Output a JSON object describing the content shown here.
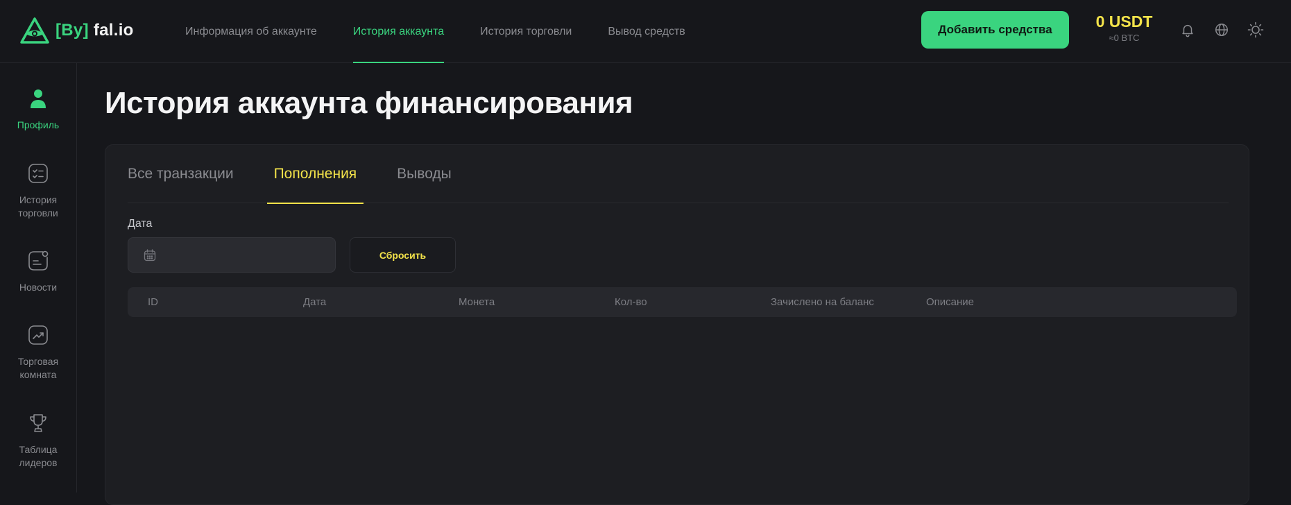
{
  "header": {
    "logo_bracket": "[By]",
    "logo_rest": "fal.io",
    "nav": [
      {
        "label": "Информация об аккаунте"
      },
      {
        "label": "История аккаунта"
      },
      {
        "label": "История торговли"
      },
      {
        "label": "Вывод средств"
      }
    ],
    "active_nav": "История аккаунта",
    "add_funds_label": "Добавить средства",
    "balance_main": "0 USDT",
    "balance_sub": "≈0 BTC",
    "icons": [
      "bell-icon",
      "globe-icon",
      "sun-icon"
    ]
  },
  "sidebar": {
    "items": [
      {
        "label": "Профиль",
        "icon": "user-icon",
        "active": true
      },
      {
        "label": "История торговли",
        "icon": "checklist-icon"
      },
      {
        "label": "Новости",
        "icon": "news-icon"
      },
      {
        "label": "Торговая комната",
        "icon": "chart-trend-icon"
      },
      {
        "label": "Таблица лидеров",
        "icon": "trophy-icon"
      }
    ]
  },
  "main": {
    "title": "История аккаунта финансирования",
    "tabs": [
      {
        "label": "Все транзакции"
      },
      {
        "label": "Пополнения"
      },
      {
        "label": "Выводы"
      }
    ],
    "active_tab": "Пополнения",
    "filter": {
      "date_label": "Дата",
      "date_value": "",
      "reset_label": "Сбросить"
    },
    "table": {
      "columns": [
        "ID",
        "Дата",
        "Монета",
        "Кол-во",
        "Зачислено на баланс",
        "Описание"
      ],
      "rows": []
    }
  },
  "colors": {
    "background": "#16171b",
    "card": "#1d1e22",
    "accent_green": "#3ad47f",
    "accent_yellow": "#f3e34a",
    "muted_text": "#8a8b90"
  }
}
